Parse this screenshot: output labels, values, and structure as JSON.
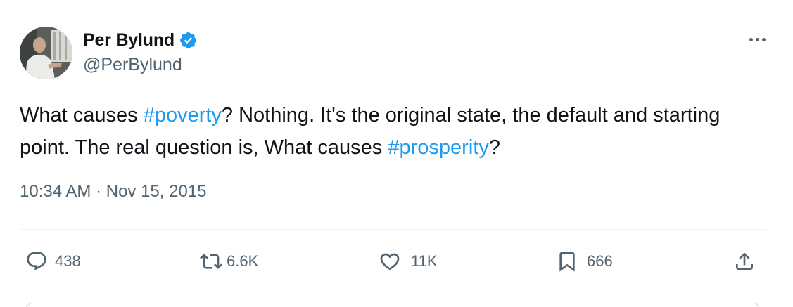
{
  "author": {
    "display_name": "Per Bylund",
    "handle": "@PerBylund"
  },
  "tweet": {
    "segments": [
      {
        "text": "What causes ",
        "type": "text"
      },
      {
        "text": "#poverty",
        "type": "hashtag"
      },
      {
        "text": "? Nothing. It's the original state, the default and starting point. The real question is, What causes ",
        "type": "text"
      },
      {
        "text": "#prosperity",
        "type": "hashtag"
      },
      {
        "text": "?",
        "type": "text"
      }
    ],
    "timestamp": "10:34 AM · Nov 15, 2015"
  },
  "actions": {
    "replies": "438",
    "reposts": "6.6K",
    "likes": "11K",
    "bookmarks": "666"
  },
  "icons": {
    "reply": "speech-bubble-icon",
    "repost": "repost-arrows-icon",
    "like": "heart-icon",
    "bookmark": "bookmark-icon",
    "share": "share-upload-icon",
    "verified": "verified-badge-icon",
    "more": "more-dots-icon"
  },
  "colors": {
    "accent": "#1d9bf0",
    "text": "#0f1419",
    "secondary": "#536471",
    "divider": "#eff3f4"
  }
}
